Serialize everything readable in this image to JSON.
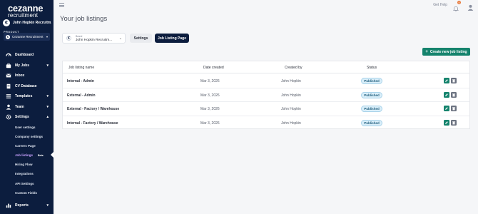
{
  "brand": {
    "line1": "cezanne",
    "line2": "recruitment"
  },
  "company": {
    "icon_letter": "€",
    "name": "John Hopkin Recruitm..."
  },
  "product": {
    "label": "PRODUCT",
    "icon_letter": "€",
    "value": "Cezanne Recruitment"
  },
  "nav": {
    "dashboard": "Dashboard",
    "my_jobs": "My Jobs",
    "inbox": "Inbox",
    "cv_database": "CV Database",
    "templates": "Templates",
    "team": "Team",
    "settings": "Settings",
    "reports": "Reports"
  },
  "settings_sub": {
    "user_settings": "User settings",
    "company_settings": "Company settings",
    "careers_page": "Careers Page",
    "job_listings": "Job listings",
    "job_listings_badge": "Beta",
    "hiring_flow": "Hiring Flow",
    "integrations": "Integrations",
    "api_settings": "API Settings",
    "custom_fields": "Custom Fields"
  },
  "topbar": {
    "help": "Get Help",
    "notifications": "9"
  },
  "page": {
    "title": "Your job listings"
  },
  "brand_select": {
    "label": "Brand",
    "icon_letter": "€",
    "value": "John Hopkin Recruitm..."
  },
  "tabs": {
    "settings": "Settings",
    "job_listing_page": "Job Listing Page"
  },
  "actions": {
    "create": "Create new job listing"
  },
  "table": {
    "headers": {
      "name": "Job listing name",
      "date": "Date created",
      "created_by": "Created by",
      "status": "Status"
    },
    "rows": [
      {
        "name": "Internal - Admin",
        "date": "Mar 3, 2026",
        "created_by": "John Hopkin",
        "status": "Published"
      },
      {
        "name": "External - Admin",
        "date": "Mar 3, 2026",
        "created_by": "John Hopkin",
        "status": "Published"
      },
      {
        "name": "External - Factory / Warehouse",
        "date": "Mar 3, 2026",
        "created_by": "John Hopkin",
        "status": "Published"
      },
      {
        "name": "Internal - Factory / Warehouse",
        "date": "Mar 3, 2026",
        "created_by": "John Hopkin",
        "status": "Published"
      }
    ]
  }
}
